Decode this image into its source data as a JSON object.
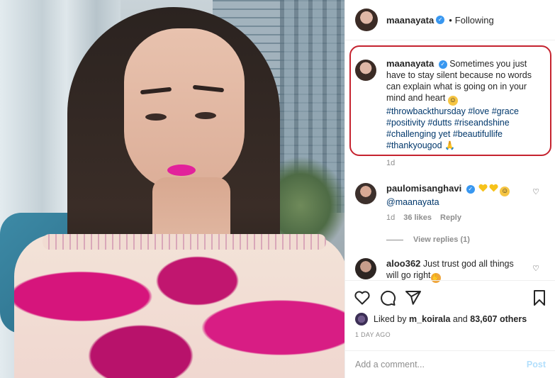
{
  "header": {
    "username": "maanayata",
    "separator": "•",
    "follow_status": "Following"
  },
  "caption": {
    "username": "maanayata",
    "text": "Sometimes you just have to stay silent because no words can explain what is going on in your mind and heart",
    "hashtags_line1": "#throwbackthursday #love #grace",
    "hashtags_line2": "#positivity #dutts #riseandshine",
    "hashtags_line3": "#challenging yet #beautifullife",
    "hashtags_line4": "#thankyougod",
    "time": "1d"
  },
  "comments": [
    {
      "username": "paulomisanghavi",
      "mention": "@maanayata",
      "time": "1d",
      "likes": "36 likes",
      "reply": "Reply",
      "view_replies": "View replies (1)"
    },
    {
      "username": "aloo362",
      "text": "Just trust god all things will go right"
    }
  ],
  "likes": {
    "prefix": "Liked by",
    "user": "m_koirala",
    "middle": "and",
    "count": "83,607 others"
  },
  "post_age": "1 DAY AGO",
  "add_comment": {
    "placeholder": "Add a comment...",
    "post_label": "Post"
  },
  "icons": [
    "verified-badge-icon",
    "heart-icon",
    "comment-icon",
    "share-icon",
    "bookmark-icon",
    "small-heart-icon"
  ],
  "colors": {
    "annotation_circle": "#c5232f",
    "link": "#00376b",
    "verified": "#3897f0",
    "post_disabled": "#b2dffc"
  }
}
